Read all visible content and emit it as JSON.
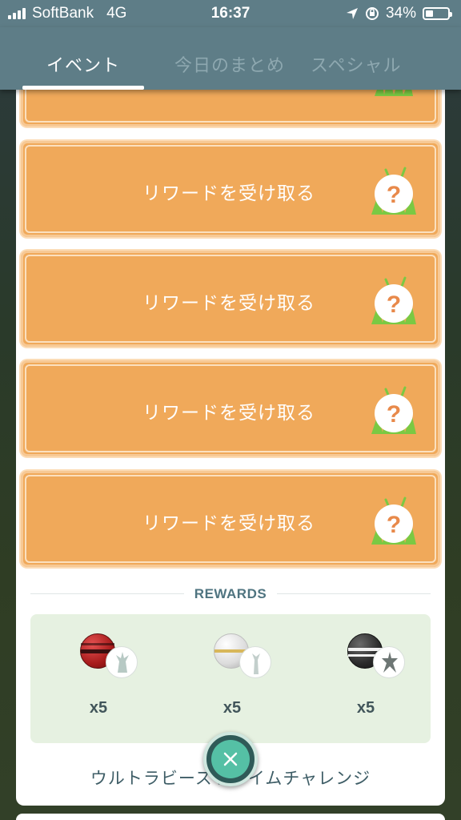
{
  "status_bar": {
    "carrier": "SoftBank",
    "network": "4G",
    "time": "16:37",
    "battery": "34%"
  },
  "tabs": [
    {
      "label": "イベント",
      "active": true
    },
    {
      "label": "今日のまとめ",
      "active": false
    },
    {
      "label": "スペシャル",
      "active": false
    }
  ],
  "reward_buttons": [
    {
      "label": "リワードを受け取る"
    },
    {
      "label": "リワードを受け取る"
    },
    {
      "label": "リワードを受け取る"
    },
    {
      "label": "リワードを受け取る"
    }
  ],
  "rewards": {
    "title": "REWARDS",
    "items": [
      {
        "icon": "beast-ball-red-icon",
        "quantity": "x5"
      },
      {
        "icon": "beast-ball-white-icon",
        "quantity": "x5"
      },
      {
        "icon": "beast-ball-black-icon",
        "quantity": "x5"
      }
    ]
  },
  "challenge_name": "ウルトラビーストタイムチャレンジ",
  "colors": {
    "header": "#5e7d87",
    "button_orange": "#f0a95a",
    "rewards_bg": "#e6f1e1",
    "close_teal": "#55c0a5"
  }
}
